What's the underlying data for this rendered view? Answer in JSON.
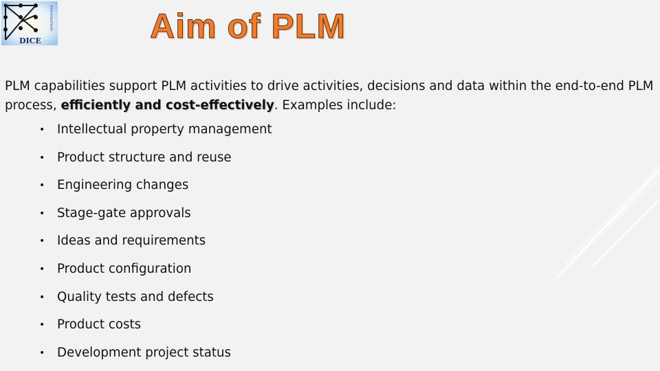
{
  "slide": {
    "title": "Aim of PLM",
    "logo": {
      "icon": "dice-foundation-logo",
      "text": "DICE",
      "side_text": "FOUNDATION"
    },
    "intro": {
      "before": "PLM capabilities support PLM activities to drive activities, decisions and data within the end-to-end PLM process, ",
      "emphasis": "efficiently and cost-effectively",
      "after": ". Examples include:"
    },
    "bullet_symbol": "•",
    "bullets": [
      "Intellectual property management",
      "Product structure and reuse",
      "Engineering changes",
      "Stage-gate approvals",
      "Ideas and requirements",
      "Product configuration",
      "Quality tests and defects",
      "Product costs",
      "Development project status"
    ]
  },
  "colors": {
    "background": "#f2f2f2",
    "title": "#ed7d31",
    "title_outline": "#5a2a0a",
    "text": "#111111",
    "logo_background": "#a9cdf0",
    "logo_lines": "#141414"
  }
}
